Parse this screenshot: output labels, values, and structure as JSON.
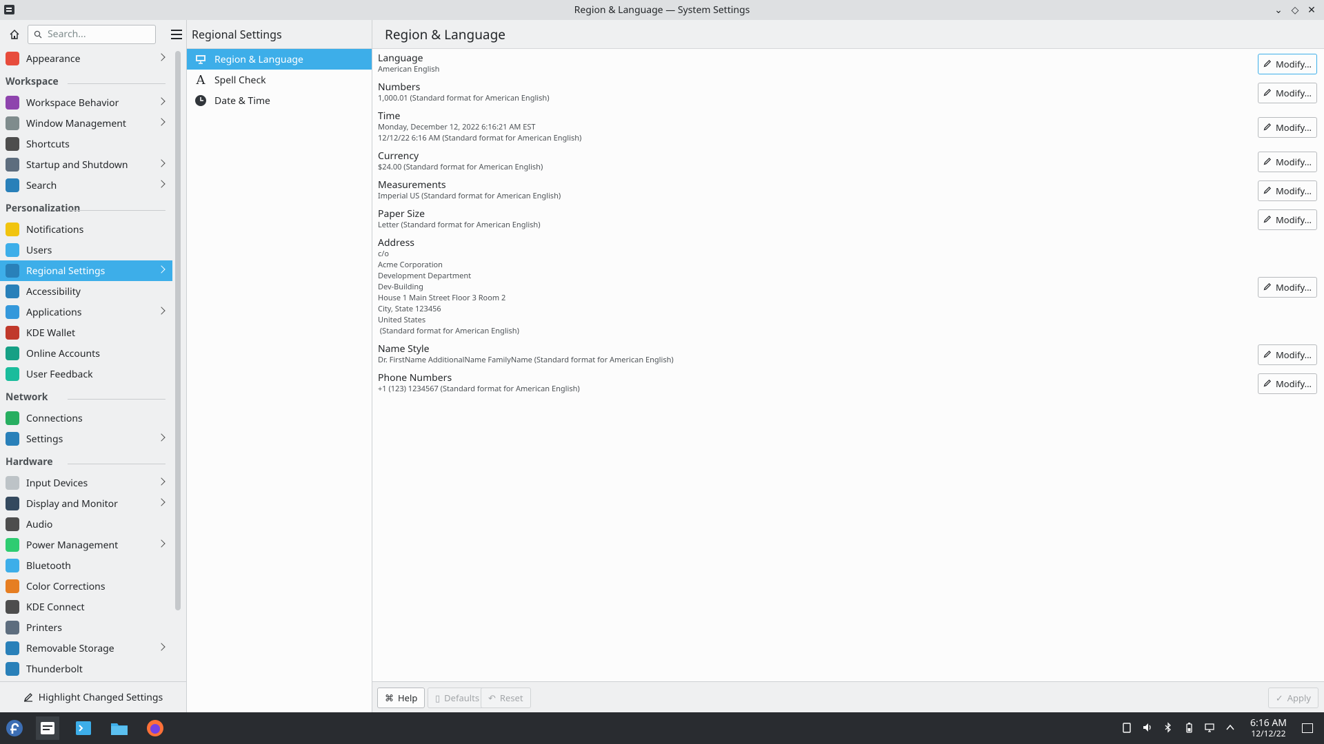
{
  "window": {
    "title": "Region & Language — System Settings"
  },
  "sidebar": {
    "search_placeholder": "Search...",
    "items": [
      {
        "type": "item",
        "label": "Appearance",
        "icon": "appearance-icon",
        "color": "#e74c3c",
        "chevron": true
      },
      {
        "type": "header",
        "label": "Workspace"
      },
      {
        "type": "item",
        "label": "Workspace Behavior",
        "icon": "workspace-behavior-icon",
        "color": "#8e44ad",
        "chevron": true
      },
      {
        "type": "item",
        "label": "Window Management",
        "icon": "window-management-icon",
        "color": "#7f8c8d",
        "chevron": true
      },
      {
        "type": "item",
        "label": "Shortcuts",
        "icon": "keyboard-icon",
        "color": "#4d4d4d",
        "chevron": false
      },
      {
        "type": "item",
        "label": "Startup and Shutdown",
        "icon": "startup-icon",
        "color": "#5d6d7e",
        "chevron": true
      },
      {
        "type": "item",
        "label": "Search",
        "icon": "search-icon",
        "color": "#2980b9",
        "chevron": true
      },
      {
        "type": "header",
        "label": "Personalization"
      },
      {
        "type": "item",
        "label": "Notifications",
        "icon": "bell-icon",
        "color": "#f1c40f",
        "chevron": false
      },
      {
        "type": "item",
        "label": "Users",
        "icon": "users-icon",
        "color": "#3daee9",
        "chevron": false
      },
      {
        "type": "item",
        "label": "Regional Settings",
        "icon": "regional-icon",
        "color": "#2980b9",
        "chevron": true,
        "active": true
      },
      {
        "type": "item",
        "label": "Accessibility",
        "icon": "accessibility-icon",
        "color": "#2980b9",
        "chevron": false
      },
      {
        "type": "item",
        "label": "Applications",
        "icon": "applications-icon",
        "color": "#3498db",
        "chevron": true
      },
      {
        "type": "item",
        "label": "KDE Wallet",
        "icon": "wallet-icon",
        "color": "#c0392b",
        "chevron": false
      },
      {
        "type": "item",
        "label": "Online Accounts",
        "icon": "online-accounts-icon",
        "color": "#16a085",
        "chevron": false
      },
      {
        "type": "item",
        "label": "User Feedback",
        "icon": "feedback-icon",
        "color": "#1abc9c",
        "chevron": false
      },
      {
        "type": "header",
        "label": "Network"
      },
      {
        "type": "item",
        "label": "Connections",
        "icon": "globe-icon",
        "color": "#27ae60",
        "chevron": false
      },
      {
        "type": "item",
        "label": "Settings",
        "icon": "network-settings-icon",
        "color": "#2980b9",
        "chevron": true
      },
      {
        "type": "header",
        "label": "Hardware"
      },
      {
        "type": "item",
        "label": "Input Devices",
        "icon": "mouse-icon",
        "color": "#bdc3c7",
        "chevron": true
      },
      {
        "type": "item",
        "label": "Display and Monitor",
        "icon": "monitor-icon",
        "color": "#34495e",
        "chevron": true
      },
      {
        "type": "item",
        "label": "Audio",
        "icon": "speaker-icon",
        "color": "#4d4d4d",
        "chevron": false
      },
      {
        "type": "item",
        "label": "Power Management",
        "icon": "power-icon",
        "color": "#2ecc71",
        "chevron": true
      },
      {
        "type": "item",
        "label": "Bluetooth",
        "icon": "bluetooth-icon",
        "color": "#3daee9",
        "chevron": false
      },
      {
        "type": "item",
        "label": "Color Corrections",
        "icon": "color-icon",
        "color": "#e67e22",
        "chevron": false
      },
      {
        "type": "item",
        "label": "KDE Connect",
        "icon": "phone-icon",
        "color": "#4d4d4d",
        "chevron": false
      },
      {
        "type": "item",
        "label": "Printers",
        "icon": "printer-icon",
        "color": "#5d6d7e",
        "chevron": false
      },
      {
        "type": "item",
        "label": "Removable Storage",
        "icon": "usb-icon",
        "color": "#2980b9",
        "chevron": true
      },
      {
        "type": "item",
        "label": "Thunderbolt",
        "icon": "thunderbolt-icon",
        "color": "#2980b9",
        "chevron": false
      }
    ],
    "highlight_label": "Highlight Changed Settings"
  },
  "subpane": {
    "title": "Regional Settings",
    "items": [
      {
        "label": "Region & Language",
        "icon": "region-icon",
        "active": true
      },
      {
        "label": "Spell Check",
        "icon": "spellcheck-icon",
        "active": false
      },
      {
        "label": "Date & Time",
        "icon": "clock-icon",
        "active": false
      }
    ]
  },
  "main": {
    "title": "Region & Language",
    "modify_label": "Modify...",
    "rows": [
      {
        "label": "Language",
        "lines": [
          "American English"
        ]
      },
      {
        "label": "Numbers",
        "lines": [
          "1,000.01 (Standard format for American English)"
        ]
      },
      {
        "label": "Time",
        "lines": [
          "Monday, December 12, 2022 6:16:21 AM EST",
          "12/12/22 6:16 AM (Standard format for American English)"
        ]
      },
      {
        "label": "Currency",
        "lines": [
          "$24.00 (Standard format for American English)"
        ]
      },
      {
        "label": "Measurements",
        "lines": [
          "Imperial US (Standard format for American English)"
        ]
      },
      {
        "label": "Paper Size",
        "lines": [
          "Letter (Standard format for American English)"
        ]
      },
      {
        "label": "Address",
        "lines": [
          "c/o",
          "Acme Corporation",
          "Development Department",
          "Dev-Building",
          "House 1 Main Street Floor 3 Room 2",
          "City, State 123456",
          "United States",
          " (Standard format for American English)"
        ]
      },
      {
        "label": "Name Style",
        "lines": [
          "Dr. FirstName AdditionalName FamilyName (Standard format for American English)"
        ]
      },
      {
        "label": "Phone Numbers",
        "lines": [
          "+1 (123) 1234567 (Standard format for American English)"
        ]
      }
    ],
    "footer": {
      "help": "Help",
      "defaults": "Defaults",
      "reset": "Reset",
      "apply": "Apply"
    }
  },
  "taskbar": {
    "time": "6:16 AM",
    "date": "12/12/22"
  }
}
